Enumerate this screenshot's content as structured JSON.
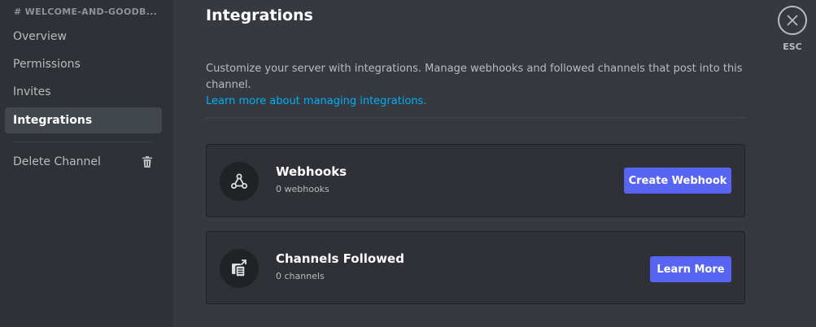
{
  "sidebar": {
    "channel_header": "# WELCOME-AND-GOODB...",
    "items": [
      {
        "label": "Overview"
      },
      {
        "label": "Permissions"
      },
      {
        "label": "Invites"
      },
      {
        "label": "Integrations"
      }
    ],
    "delete_channel": "Delete Channel"
  },
  "main": {
    "title": "Integrations",
    "description": "Customize your server with integrations. Manage webhooks and followed channels that post into this channel.",
    "learn_more_link": "Learn more about managing integrations.",
    "cards": [
      {
        "title": "Webhooks",
        "subtitle": "0 webhooks",
        "button": "Create Webhook",
        "icon": "webhook-icon"
      },
      {
        "title": "Channels Followed",
        "subtitle": "0 channels",
        "button": "Learn More",
        "icon": "channel-follow-icon"
      }
    ]
  },
  "close": {
    "label": "ESC",
    "icon": "close-icon"
  },
  "colors": {
    "accent": "#5865f2",
    "link": "#00aff4",
    "sidebar_bg": "#2f3136",
    "main_bg": "#36393f"
  }
}
